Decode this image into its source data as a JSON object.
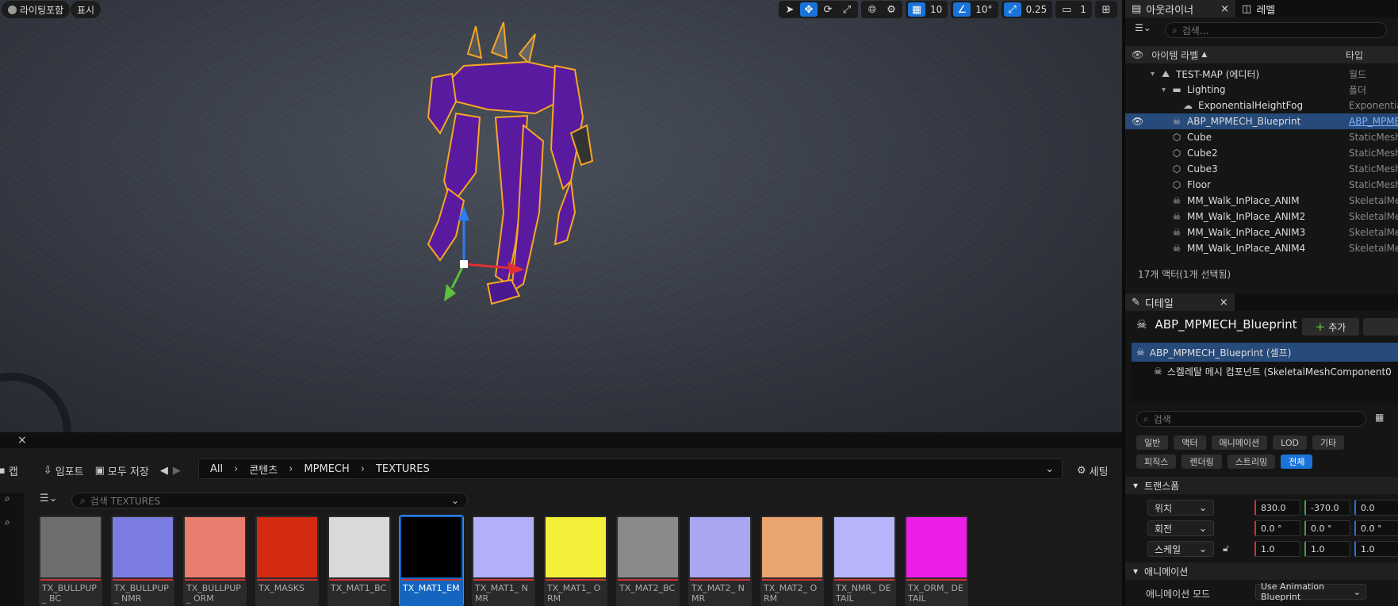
{
  "viewport": {
    "lighting_label": "라이팅포함",
    "show_label": "표시",
    "grid_value": "10",
    "angle_value": "10°",
    "scale_value": "0.25",
    "camera_value": "1"
  },
  "content_browser": {
    "tab_close": "×",
    "left_tab": "캡",
    "import_label": "임포트",
    "save_all_label": "모두 저장",
    "breadcrumb": [
      "All",
      "콘텐츠",
      "MPMECH",
      "TEXTURES"
    ],
    "settings_label": "세팅",
    "search_placeholder": "검색 TEXTURES",
    "assets": [
      {
        "name": "TX_BULLPUP_ BC",
        "color": "#6e6e6e"
      },
      {
        "name": "TX_BULLPUP_ NMR",
        "color": "#7b7de0"
      },
      {
        "name": "TX_BULLPUP_ ORM",
        "color": "#e87d70"
      },
      {
        "name": "TX_MASKS",
        "color": "#d42a10"
      },
      {
        "name": "TX_MAT1_BC",
        "color": "#d9d9d9"
      },
      {
        "name": "TX_MAT1_EM",
        "color": "#000000"
      },
      {
        "name": "TX_MAT1_ NMR",
        "color": "#b2b0fa"
      },
      {
        "name": "TX_MAT1_ ORM",
        "color": "#f3f03a"
      },
      {
        "name": "TX_MAT2_BC",
        "color": "#8a8a8a"
      },
      {
        "name": "TX_MAT2_ NMR",
        "color": "#aaa6f2"
      },
      {
        "name": "TX_MAT2_ ORM",
        "color": "#e9a46f"
      },
      {
        "name": "TX_NMR_ DETAIL",
        "color": "#b7b5fb"
      },
      {
        "name": "TX_ORM_ DETAIL",
        "color": "#ee1ee8"
      }
    ]
  },
  "outliner": {
    "tab_label": "아웃라이너",
    "level_tab": "레벨",
    "search_placeholder": "검색...",
    "col_label": "아이템 라벨",
    "col_type": "타입",
    "rows": [
      {
        "label": "TEST-MAP (에디터)",
        "type": "월드",
        "indent": 1,
        "icon": "map-icon",
        "glyph": "⛰"
      },
      {
        "label": "Lighting",
        "type": "폴더",
        "indent": 2,
        "icon": "folder-icon",
        "glyph": "▬"
      },
      {
        "label": "ExponentialHeightFog",
        "type": "Exponential",
        "indent": 3,
        "icon": "fog-icon",
        "glyph": "☁"
      },
      {
        "label": "ABP_MPMECH_Blueprint",
        "type": "ABP_MPMEC",
        "indent": 2,
        "icon": "skeleton-icon",
        "glyph": "☠"
      },
      {
        "label": "Cube",
        "type": "StaticMesh",
        "indent": 2,
        "icon": "cube-icon",
        "glyph": "⬡"
      },
      {
        "label": "Cube2",
        "type": "StaticMesh",
        "indent": 2,
        "icon": "cube-icon",
        "glyph": "⬡"
      },
      {
        "label": "Cube3",
        "type": "StaticMesh",
        "indent": 2,
        "icon": "cube-icon",
        "glyph": "⬡"
      },
      {
        "label": "Floor",
        "type": "StaticMesh",
        "indent": 2,
        "icon": "cube-icon",
        "glyph": "⬡"
      },
      {
        "label": "MM_Walk_InPlace_ANIM",
        "type": "SkeletalMe",
        "indent": 2,
        "icon": "skeleton-icon",
        "glyph": "☠"
      },
      {
        "label": "MM_Walk_InPlace_ANIM2",
        "type": "SkeletalMe",
        "indent": 2,
        "icon": "skeleton-icon",
        "glyph": "☠"
      },
      {
        "label": "MM_Walk_InPlace_ANIM3",
        "type": "SkeletalMe",
        "indent": 2,
        "icon": "skeleton-icon",
        "glyph": "☠"
      },
      {
        "label": "MM_Walk_InPlace_ANIM4",
        "type": "SkeletalMe",
        "indent": 2,
        "icon": "skeleton-icon",
        "glyph": "☠"
      }
    ],
    "selected_row": "ABP_MPMECH_Blueprint",
    "actor_count": "17개 액터(1개 선택됨)"
  },
  "details": {
    "tab_label": "디테일",
    "title": "ABP_MPMECH_Blueprint",
    "add_label": "추가",
    "components": [
      "ABP_MPMECH_Blueprint (셀프)",
      "스켈레탈 메시 컴포넌트 (SkeletalMeshComponent0"
    ],
    "search_placeholder": "검색",
    "categories_row1": [
      "일반",
      "액터",
      "애니메이션",
      "LOD",
      "기타"
    ],
    "categories_row2": [
      "피직스",
      "렌더링",
      "스트리밍",
      "전체"
    ],
    "active_category": "전체",
    "transform_section": "트랜스폼",
    "location_label": "위치",
    "rotation_label": "회전",
    "scale_label": "스케일",
    "location": [
      "830.0",
      "-370.0",
      "0.0"
    ],
    "rotation": [
      "0.0 °",
      "0.0 °",
      "0.0 °"
    ],
    "scale": [
      "1.0",
      "1.0",
      "1.0"
    ],
    "animation_section": "애니메이션",
    "anim_mode_label": "애니메이션 모드",
    "anim_mode_value": "Use Animation Blueprint"
  }
}
